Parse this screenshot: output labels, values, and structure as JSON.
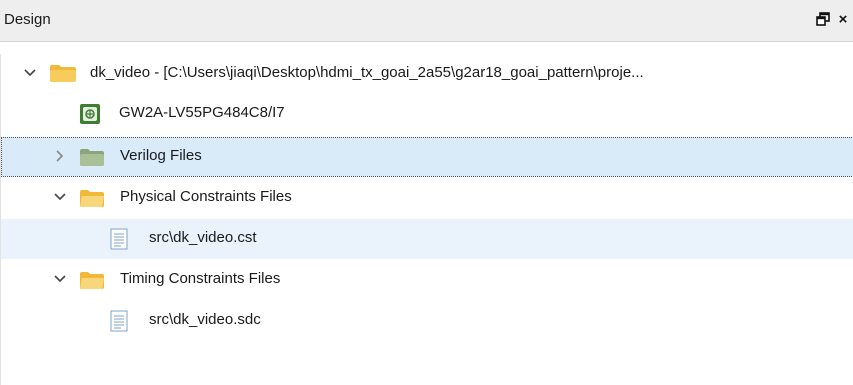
{
  "panel": {
    "title": "Design",
    "float_icon": "float-window-icon",
    "close_label": "×"
  },
  "tree": {
    "project": {
      "label": "dk_video - [C:\\Users\\jiaqi\\Desktop\\hdmi_tx_goai_2a55\\g2ar18_goai_pattern\\proje...",
      "expanded": true,
      "icon": "project-folder-icon",
      "color": "#f5c542"
    },
    "device": {
      "label": "GW2A-LV55PG484C8/I7",
      "icon": "chip-icon",
      "color": "#4b8b3b"
    },
    "verilog": {
      "label": "Verilog Files",
      "expanded": false,
      "icon": "folder-icon",
      "selected": true
    },
    "physical": {
      "label": "Physical Constraints Files",
      "expanded": true,
      "icon": "folder-icon"
    },
    "cst_file": {
      "label": "src\\dk_video.cst",
      "icon": "file-icon",
      "hover": true
    },
    "timing": {
      "label": "Timing Constraints Files",
      "expanded": true,
      "icon": "folder-icon"
    },
    "sdc_file": {
      "label": "src\\dk_video.sdc",
      "icon": "file-icon"
    }
  }
}
